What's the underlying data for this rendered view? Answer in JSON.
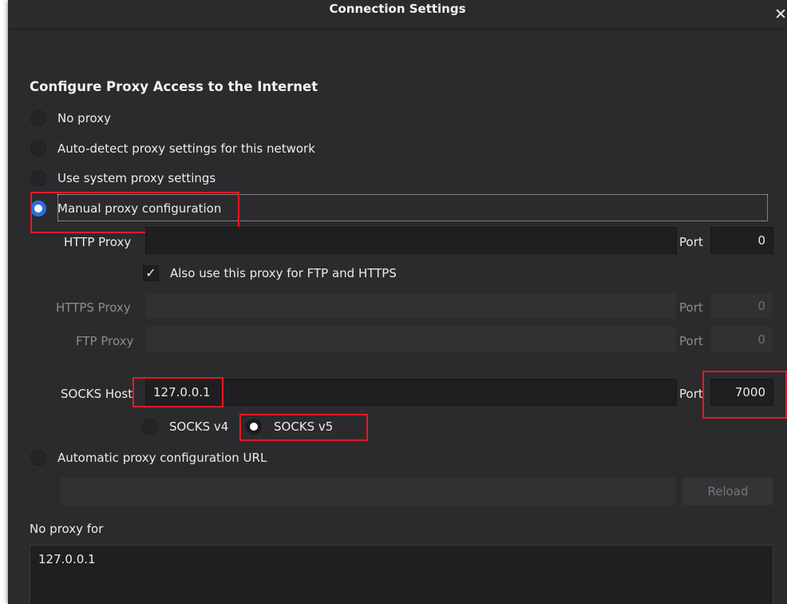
{
  "window": {
    "title": "Connection Settings",
    "close_glyph": "✕"
  },
  "heading": "Configure Proxy Access to the Internet",
  "proxy_options": {
    "no_proxy": "No proxy",
    "auto_detect": "Auto-detect proxy settings for this network",
    "system": "Use system proxy settings",
    "manual": "Manual proxy configuration",
    "auto_url": "Automatic proxy configuration URL"
  },
  "selected_option": "manual",
  "http": {
    "label": "HTTP Proxy",
    "value": "",
    "port_label": "Port",
    "port": "0"
  },
  "also_use": {
    "label": "Also use this proxy for FTP and HTTPS",
    "checked": true,
    "glyph": "✓"
  },
  "https": {
    "label": "HTTPS Proxy",
    "value": "",
    "port_label": "Port",
    "port": "0"
  },
  "ftp": {
    "label": "FTP Proxy",
    "value": "",
    "port_label": "Port",
    "port": "0"
  },
  "socks": {
    "label": "SOCKS Host",
    "value": "127.0.0.1",
    "port_label": "Port",
    "port": "7000",
    "v4": "SOCKS v4",
    "v5": "SOCKS v5",
    "selected": "v5"
  },
  "auto_url_field": {
    "value": ""
  },
  "reload_button": "Reload",
  "no_proxy_for": {
    "label": "No proxy for",
    "value": "127.0.0.1"
  },
  "colors": {
    "accent": "#2a6fd6",
    "highlight": "#e01b24",
    "background": "#2b2b2e"
  }
}
